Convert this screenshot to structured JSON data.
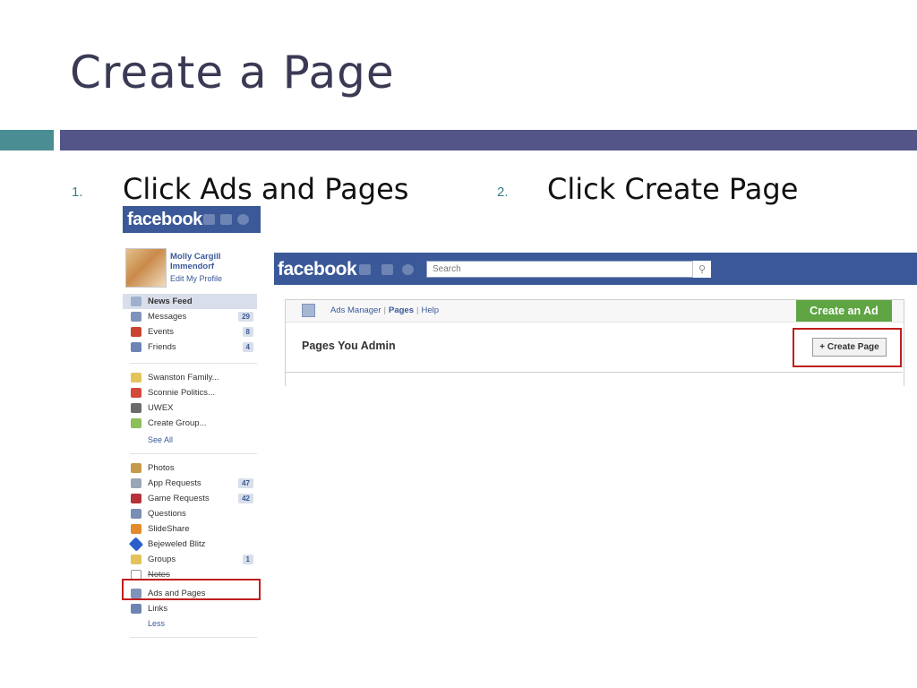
{
  "slide": {
    "title": "Create a Page",
    "steps": [
      {
        "num": "1.",
        "text": "Click Ads and Pages"
      },
      {
        "num": "2.",
        "text": "Click Create Page"
      }
    ]
  },
  "left_screenshot": {
    "logo": "facebook",
    "profile": {
      "name": "Molly Cargill Immendorf",
      "edit_link": "Edit My Profile"
    },
    "items_main": [
      {
        "label": "News Feed",
        "count": ""
      },
      {
        "label": "Messages",
        "count": "29"
      },
      {
        "label": "Events",
        "count": "8"
      },
      {
        "label": "Friends",
        "count": "4"
      }
    ],
    "items_groups": [
      {
        "label": "Swanston Family..."
      },
      {
        "label": "Sconnie Politics..."
      },
      {
        "label": "UWEX"
      },
      {
        "label": "Create Group..."
      }
    ],
    "see_all": "See All",
    "items_apps": [
      {
        "label": "Photos",
        "count": ""
      },
      {
        "label": "App Requests",
        "count": "47"
      },
      {
        "label": "Game Requests",
        "count": "42"
      },
      {
        "label": "Questions",
        "count": ""
      },
      {
        "label": "SlideShare",
        "count": ""
      },
      {
        "label": "Bejeweled Blitz",
        "count": ""
      },
      {
        "label": "Groups",
        "count": "1"
      },
      {
        "label": "Notes",
        "count": ""
      },
      {
        "label": "Ads and Pages",
        "count": ""
      },
      {
        "label": "Links",
        "count": ""
      }
    ],
    "less": "Less"
  },
  "right_screenshot": {
    "logo": "facebook",
    "search_placeholder": "Search",
    "toolbar": {
      "ads_manager": "Ads Manager",
      "pages": "Pages",
      "help": "Help",
      "sep": "|"
    },
    "create_ad": "Create an Ad",
    "pages_you_admin": "Pages You Admin",
    "create_page": "+ Create Page"
  },
  "colors": {
    "facebook_blue": "#3b5998",
    "highlight_red": "#c01e1e",
    "create_ad_green": "#5fa543",
    "title_bar": "#535488",
    "accent_teal": "#4a8d92"
  }
}
